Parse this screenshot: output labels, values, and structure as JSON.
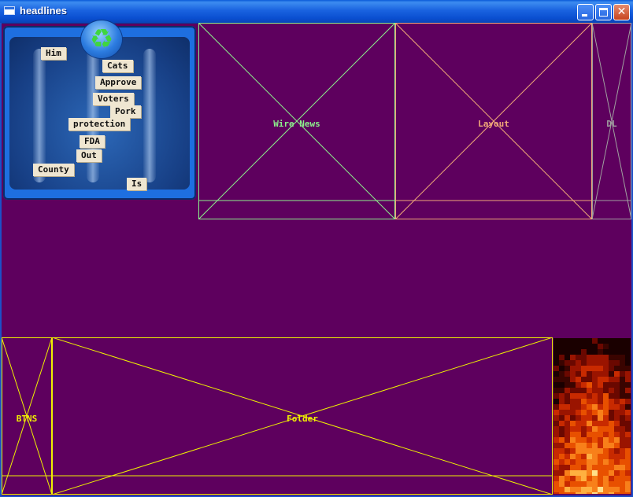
{
  "window": {
    "title": "headlines"
  },
  "colors": {
    "background": "#5e005e",
    "wire": "#8cf08c",
    "layout": "#f0a878",
    "dl": "#a0a0a0",
    "folder": "#f0f000"
  },
  "magnet": {
    "words": [
      "Him",
      "Cats",
      "Approve",
      "Voters",
      "Pork",
      "protection",
      "FDA",
      "Out",
      "County",
      "Is"
    ],
    "icon": "recycle-icon"
  },
  "panels": {
    "wire_news": "Wire News",
    "layout": "Layout",
    "dl": "DL",
    "btns": "BTNS",
    "folder": "Folder"
  }
}
